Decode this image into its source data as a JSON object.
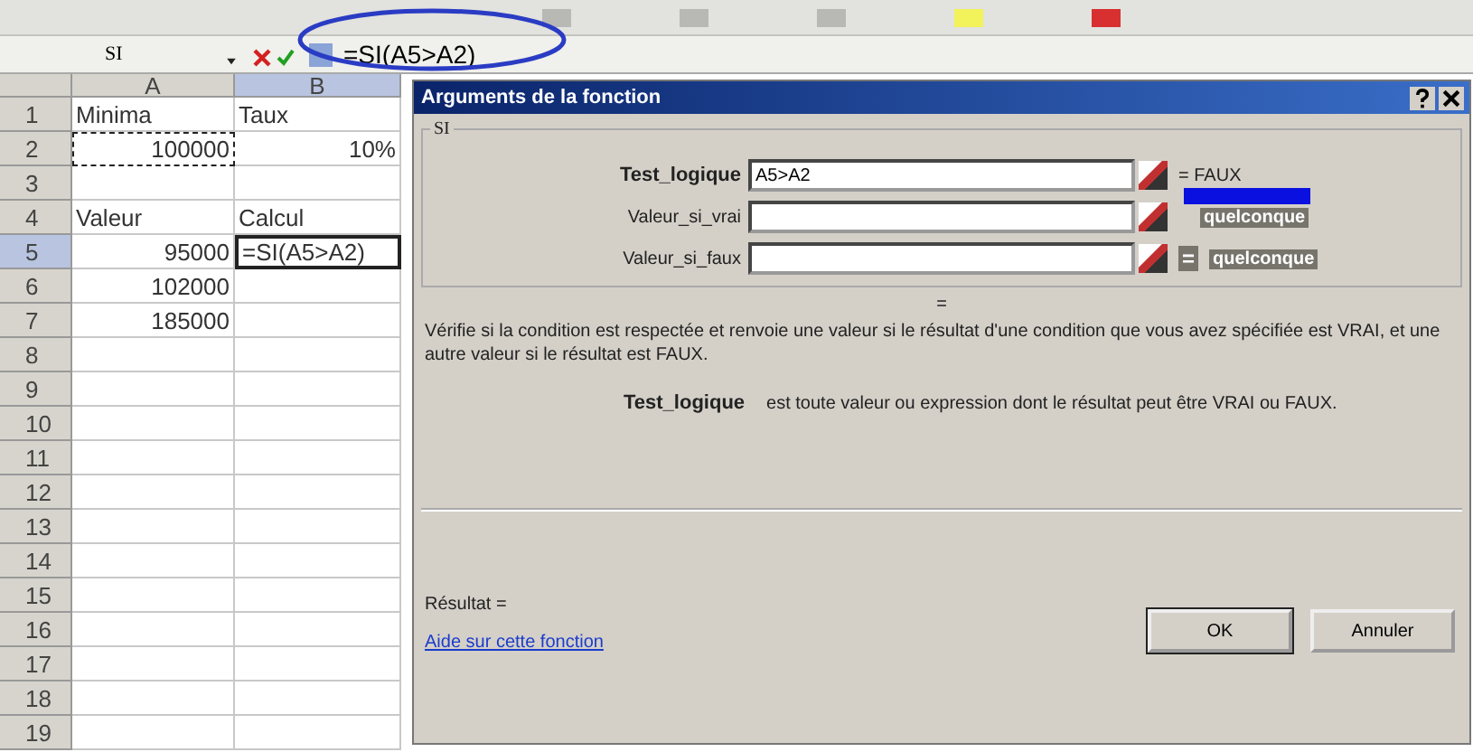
{
  "formula_bar": {
    "name_box": "SI",
    "formula": "=SI(A5>A2)"
  },
  "sheet": {
    "columns": [
      {
        "label": "A",
        "selected": false
      },
      {
        "label": "B",
        "selected": true
      }
    ],
    "rows": [
      {
        "number": "1",
        "selected": false,
        "cells": [
          {
            "text": "Minima",
            "kind": "text"
          },
          {
            "text": "Taux",
            "kind": "text"
          }
        ]
      },
      {
        "number": "2",
        "selected": false,
        "cells": [
          {
            "text": "100000",
            "kind": "number",
            "marquee": true
          },
          {
            "text": "10%",
            "kind": "number"
          }
        ]
      },
      {
        "number": "3",
        "selected": false,
        "cells": []
      },
      {
        "number": "4",
        "selected": false,
        "cells": [
          {
            "text": "Valeur",
            "kind": "text"
          },
          {
            "text": "Calcul",
            "kind": "text"
          }
        ]
      },
      {
        "number": "5",
        "selected": true,
        "cells": [
          {
            "text": "95000",
            "kind": "number"
          },
          {
            "text": "=SI(A5>A2)",
            "kind": "text",
            "active": true
          }
        ]
      },
      {
        "number": "6",
        "selected": false,
        "cells": [
          {
            "text": "102000",
            "kind": "number"
          }
        ]
      },
      {
        "number": "7",
        "selected": false,
        "cells": [
          {
            "text": "185000",
            "kind": "number"
          }
        ]
      },
      {
        "number": "8",
        "selected": false,
        "cells": []
      },
      {
        "number": "9",
        "selected": false,
        "cells": []
      },
      {
        "number": "10",
        "selected": false,
        "cells": []
      },
      {
        "number": "11",
        "selected": false,
        "cells": []
      },
      {
        "number": "12",
        "selected": false,
        "cells": []
      },
      {
        "number": "13",
        "selected": false,
        "cells": []
      },
      {
        "number": "14",
        "selected": false,
        "cells": []
      },
      {
        "number": "15",
        "selected": false,
        "cells": []
      },
      {
        "number": "16",
        "selected": false,
        "cells": []
      },
      {
        "number": "17",
        "selected": false,
        "cells": []
      },
      {
        "number": "18",
        "selected": false,
        "cells": []
      },
      {
        "number": "19",
        "selected": false,
        "cells": []
      }
    ]
  },
  "dialog": {
    "title": "Arguments de la fonction",
    "function_name": "SI",
    "arguments": [
      {
        "label": "Test_logique",
        "required": true,
        "value": "A5>A2",
        "result": "= FAUX",
        "kind": "value"
      },
      {
        "label": "Valeur_si_vrai",
        "required": false,
        "result": "quelconque",
        "kind": "type"
      },
      {
        "label": "Valeur_si_faux",
        "required": false,
        "sign": "=",
        "result": "quelconque",
        "kind": "type"
      }
    ],
    "formula_result": "=",
    "description": "Vérifie si la condition est respectée et renvoie une valeur si le résultat d'une condition que vous avez spécifiée est VRAI, et une autre valeur si le résultat est FAUX.",
    "argument_help": {
      "name": "Test_logique",
      "text": "est toute valeur ou expression dont le résultat peut être VRAI ou FAUX."
    },
    "result_label": "Résultat =",
    "help_link": "Aide sur cette fonction",
    "buttons": [
      "OK",
      "Annuler"
    ]
  }
}
